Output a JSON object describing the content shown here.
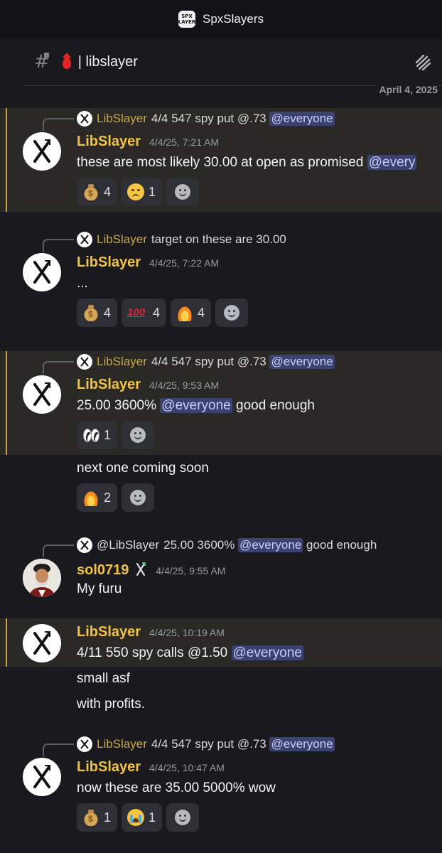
{
  "app": {
    "title": "SpxSlayers",
    "logo_text": "SPX SLAYERS"
  },
  "channel": {
    "name": "| libslayer",
    "date": "April 4, 2025"
  },
  "colors": {
    "author": "#f0c245",
    "mention_bg": "#3c4270",
    "highlight_bar": "#c9a53a"
  },
  "messages": [
    {
      "reply": {
        "author": "LibSlayer",
        "text": "4/4 547 spy put @.73",
        "mention": "@everyone"
      },
      "author": "LibSlayer",
      "timestamp": "4/4/25, 7:21 AM",
      "text": "these are most likely 30.00 at open as promised",
      "mention": "@every",
      "reactions": [
        {
          "emoji": "money-bag",
          "count": "4"
        },
        {
          "emoji": "disappointed-face",
          "count": "1"
        }
      ]
    },
    {
      "reply": {
        "author": "LibSlayer",
        "text": "target on these are 30.00"
      },
      "author": "LibSlayer",
      "timestamp": "4/4/25, 7:22 AM",
      "text": "...",
      "reactions": [
        {
          "emoji": "money-bag",
          "count": "4"
        },
        {
          "emoji": "hundred-points",
          "count": "4"
        },
        {
          "emoji": "fire",
          "count": "4"
        }
      ]
    },
    {
      "reply": {
        "author": "LibSlayer",
        "text": "4/4 547 spy put @.73",
        "mention": "@everyone"
      },
      "author": "LibSlayer",
      "timestamp": "4/4/25, 9:53 AM",
      "text_a": "25.00 3600%",
      "mention": "@everyone",
      "text_b": "good enough",
      "reactions": [
        {
          "emoji": "eyes",
          "count": "1"
        }
      ],
      "followup": {
        "text": "next one coming soon",
        "reactions": [
          {
            "emoji": "fire",
            "count": "2"
          }
        ]
      }
    },
    {
      "reply": {
        "author": "@LibSlayer",
        "text_a": "25.00 3600%",
        "mention": "@everyone",
        "text_b": "good enough"
      },
      "author": "sol0719",
      "timestamp": "4/4/25, 9:55 AM",
      "text": "My furu"
    },
    {
      "author": "LibSlayer",
      "timestamp": "4/4/25, 10:19 AM",
      "text": "4/11 550 spy calls @1.50",
      "mention": "@everyone",
      "lines": [
        "small asf",
        "with profits."
      ]
    },
    {
      "reply": {
        "author": "LibSlayer",
        "text": "4/4 547 spy put @.73",
        "mention": "@everyone"
      },
      "author": "LibSlayer",
      "timestamp": "4/4/25, 10:47 AM",
      "text": "now these are 35.00 5000% wow",
      "reactions": [
        {
          "emoji": "money-bag",
          "count": "1"
        },
        {
          "emoji": "loudly-crying-face",
          "count": "1"
        }
      ]
    }
  ]
}
